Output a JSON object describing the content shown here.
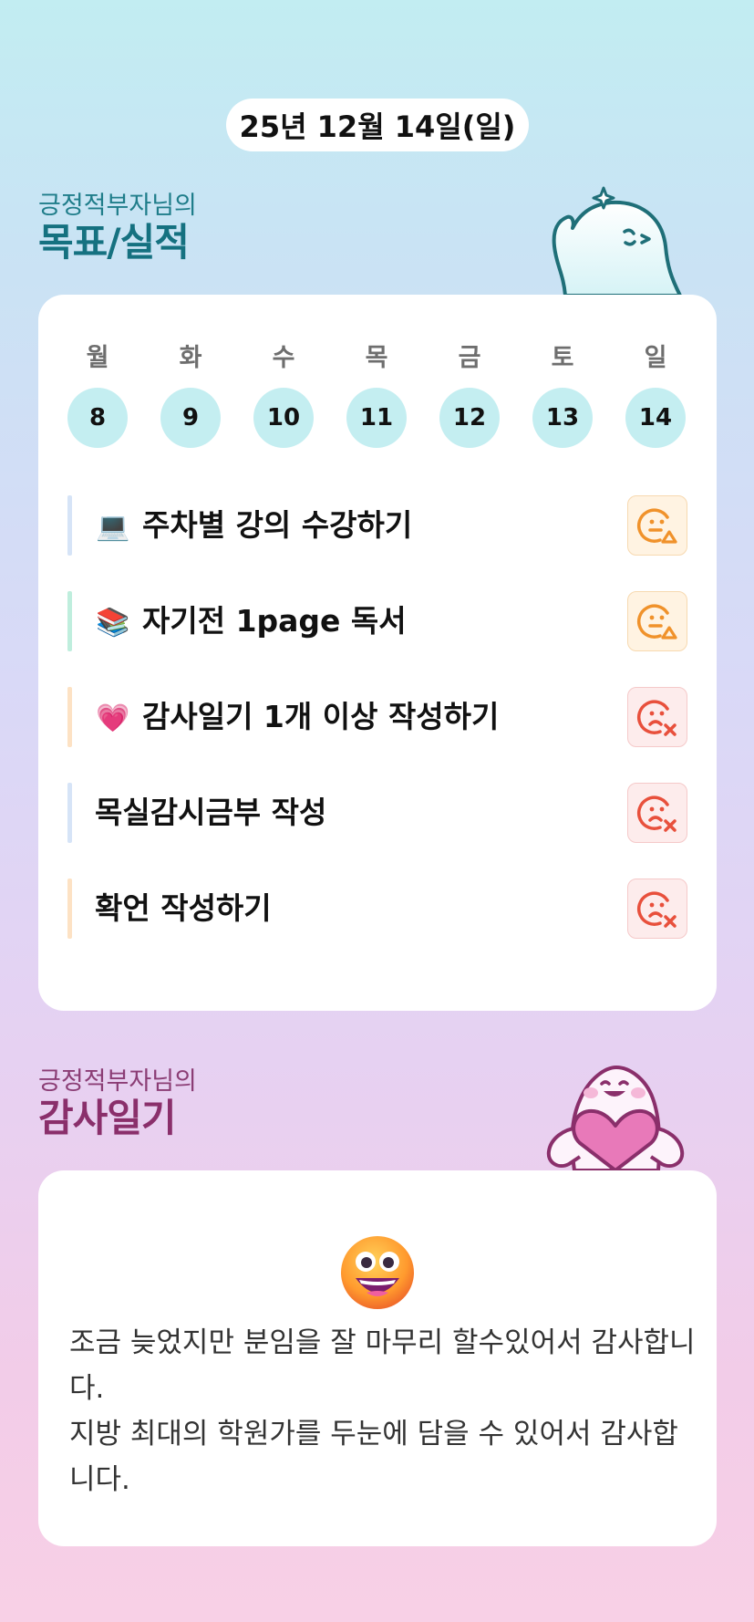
{
  "header": {
    "date": "25년 12월 14일(일)"
  },
  "goals_section": {
    "subtitle": "긍정적부자님의",
    "title": "목표/실적",
    "week": [
      {
        "day": "월",
        "date": "8"
      },
      {
        "day": "화",
        "date": "9"
      },
      {
        "day": "수",
        "date": "10"
      },
      {
        "day": "목",
        "date": "11"
      },
      {
        "day": "금",
        "date": "12"
      },
      {
        "day": "토",
        "date": "13"
      },
      {
        "day": "일",
        "date": "14"
      }
    ],
    "goals": [
      {
        "emoji": "💻",
        "text": "주차별 강의 수강하기",
        "bar_color": "#d6e4f7",
        "status": "partial-face-icon"
      },
      {
        "emoji": "📚",
        "text": "자기전 1page 독서",
        "bar_color": "#bfeedd",
        "status": "partial-face-icon"
      },
      {
        "emoji": "💗",
        "text": "감사일기 1개 이상 작성하기",
        "bar_color": "#fde2c4",
        "status": "fail-face-icon"
      },
      {
        "emoji": "",
        "text": "목실감시금부 작성",
        "bar_color": "#d6e4f7",
        "status": "fail-face-icon"
      },
      {
        "emoji": "",
        "text": "확언 작성하기",
        "bar_color": "#fde2c4",
        "status": "fail-face-icon"
      }
    ]
  },
  "thanks_section": {
    "subtitle": "긍정적부자님의",
    "title": "감사일기",
    "emoji": "grinning-face-icon",
    "lines": [
      "조금 늦었지만 분임을 잘 마무리 할수있어서 감사합니다.",
      "지방 최대의 학원가를 두눈에 담을 수 있어서 감사합니다."
    ]
  },
  "colors": {
    "partial": "#f0922b",
    "fail": "#e8503c",
    "day_circle": "#c4eef1"
  }
}
